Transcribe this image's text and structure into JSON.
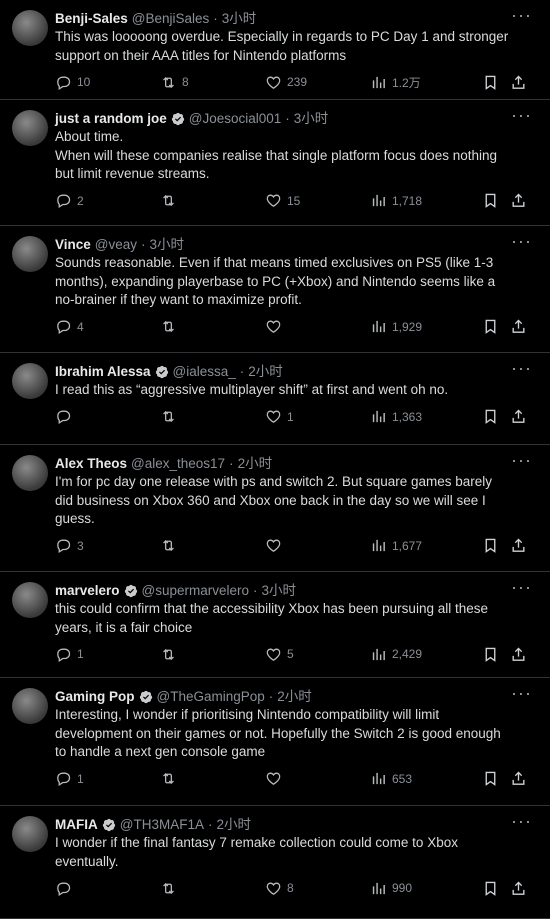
{
  "tweets": [
    {
      "name": "Benji-Sales",
      "handle": "@BenjiSales",
      "time": "3小时",
      "verified": false,
      "lines": [
        "This was looooong overdue. Especially in regards to PC Day 1 and stronger",
        "support on their AAA titles for Nintendo platforms"
      ],
      "replies": "10",
      "retweets": "8",
      "likes": "239",
      "views": "1.2万"
    },
    {
      "name": "just a random joe",
      "handle": "@Joesocial001",
      "time": "3小时",
      "verified": true,
      "lines": [
        "About time.",
        "When will these companies realise that single platform focus does nothing",
        "but limit revenue streams."
      ],
      "replies": "2",
      "retweets": "",
      "likes": "15",
      "views": "1,718"
    },
    {
      "name": "Vince",
      "handle": "@veay",
      "time": "3小时",
      "verified": false,
      "lines": [
        "Sounds reasonable. Even if that means timed exclusives on PS5 (like 1-3",
        "months), expanding playerbase to PC (+Xbox) and Nintendo seems like a",
        "no-brainer if they want to maximize profit."
      ],
      "replies": "4",
      "retweets": "",
      "likes": "",
      "views": "1,929"
    },
    {
      "name": "Ibrahim Alessa",
      "handle": "@ialessa_",
      "time": "2小时",
      "verified": true,
      "lines": [
        "I read this as “aggressive multiplayer shift” at first and went oh no."
      ],
      "replies": "",
      "retweets": "",
      "likes": "1",
      "views": "1,363"
    },
    {
      "name": "Alex Theos",
      "handle": "@alex_theos17",
      "time": "2小时",
      "verified": false,
      "lines": [
        "I'm for pc day one release with ps and switch 2. But square games barely",
        "did business on Xbox 360 and Xbox one back in the day so we will see I",
        "guess."
      ],
      "replies": "3",
      "retweets": "",
      "likes": "",
      "views": "1,677"
    },
    {
      "name": "marvelero",
      "handle": "@supermarvelero",
      "time": "3小时",
      "verified": true,
      "lines": [
        "this could confirm that the accessibility Xbox has been pursuing all these",
        "years, it is a fair choice"
      ],
      "replies": "1",
      "retweets": "",
      "likes": "5",
      "views": "2,429"
    },
    {
      "name": "Gaming Pop",
      "handle": "@TheGamingPop",
      "time": "2小时",
      "verified": true,
      "lines": [
        "Interesting, I wonder if prioritising Nintendo compatibility will limit",
        "development on their games or not. Hopefully the Switch 2 is good enough",
        "to handle a next gen console game"
      ],
      "replies": "1",
      "retweets": "",
      "likes": "",
      "views": "653"
    },
    {
      "name": "MAFIA",
      "handle": "@TH3MAF1A",
      "time": "2小时",
      "verified": true,
      "lines": [
        "I wonder if the final fantasy 7 remake collection could come to Xbox",
        "eventually."
      ],
      "replies": "",
      "retweets": "",
      "likes": "8",
      "views": "990"
    }
  ],
  "dot": "·",
  "more": "···",
  "icons": {
    "reply": "reply-icon",
    "retweet": "retweet-icon",
    "like": "heart-icon",
    "views": "views-chart-icon",
    "bookmark": "bookmark-icon",
    "share": "share-icon",
    "verified": "verified-badge-icon"
  }
}
